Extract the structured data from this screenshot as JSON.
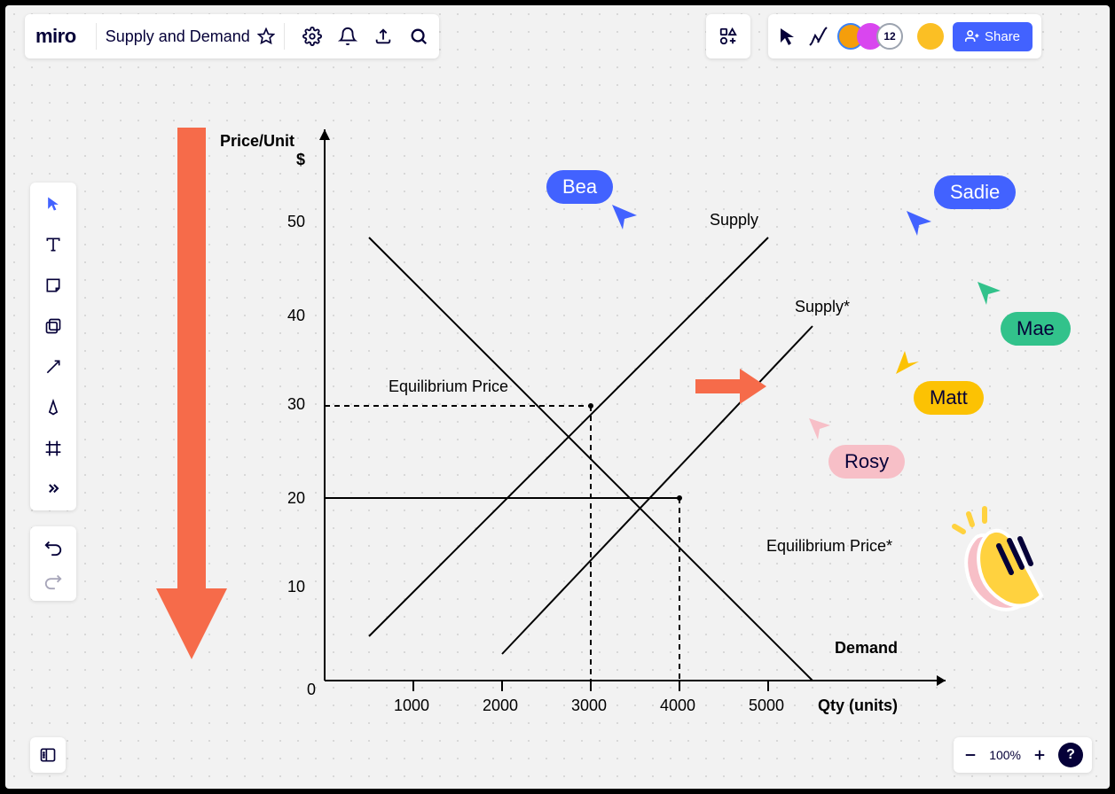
{
  "header": {
    "logo": "miro",
    "board_title": "Supply and Demand",
    "share_label": "Share",
    "collaborator_count": "12"
  },
  "zoom": {
    "level": "100%"
  },
  "cursors": {
    "bea": "Bea",
    "sadie": "Sadie",
    "mae": "Mae",
    "matt": "Matt",
    "rosy": "Rosy"
  },
  "chart_data": {
    "type": "line",
    "title": "",
    "xlabel": "Qty (units)",
    "ylabel": "Price/Unit $",
    "xlim": [
      0,
      5500
    ],
    "ylim": [
      0,
      52
    ],
    "x_ticks": [
      1000,
      2000,
      3000,
      4000,
      5000
    ],
    "y_ticks": [
      0,
      10,
      20,
      30,
      40,
      50
    ],
    "series": [
      {
        "name": "Supply",
        "x": [
          500,
          5000
        ],
        "y": [
          5,
          50
        ]
      },
      {
        "name": "Demand",
        "x": [
          500,
          5500
        ],
        "y": [
          50,
          0
        ]
      },
      {
        "name": "Supply*",
        "x": [
          1500,
          5500
        ],
        "y": [
          5,
          45
        ]
      }
    ],
    "equilibrium": {
      "label": "Equilibrium Price",
      "qty": 3000,
      "price": 30
    },
    "equilibrium_star": {
      "label": "Equilibrium Price*",
      "qty": 4000,
      "price": 20
    },
    "legend_supply": "Supply",
    "legend_supply_star": "Supply*",
    "legend_demand": "Demand"
  },
  "labels": {
    "price_unit": "Price/Unit",
    "dollar": "$",
    "qty_units": "Qty (units)",
    "equilibrium": "Equilibrium Price",
    "equilibrium_star": "Equilibrium Price*",
    "supply": "Supply",
    "supply_star": "Supply*",
    "demand": "Demand",
    "tick_1000": "1000",
    "tick_2000": "2000",
    "tick_3000": "3000",
    "tick_4000": "4000",
    "tick_5000": "5000",
    "ytick_0": "0",
    "ytick_10": "10",
    "ytick_20": "20",
    "ytick_30": "30",
    "ytick_40": "40",
    "ytick_50": "50"
  }
}
